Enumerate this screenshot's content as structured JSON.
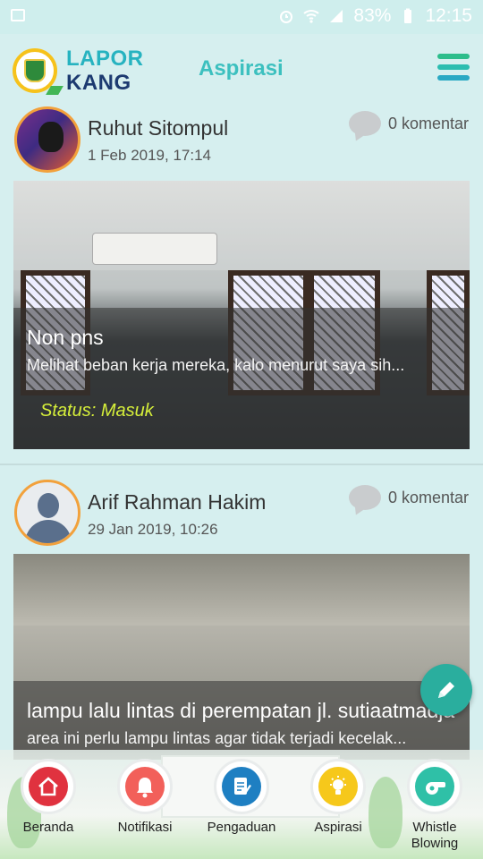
{
  "status_bar": {
    "battery": "83%",
    "time": "12:15"
  },
  "header": {
    "logo_line1": "LAPOR",
    "logo_line2": "KANG",
    "title": "Aspirasi"
  },
  "posts": [
    {
      "author": "Ruhut Sitompul",
      "date": "1 Feb 2019, 17:14",
      "comments": "0 komentar",
      "title": "Non pns",
      "description": "Melihat beban kerja mereka, kalo menurut saya sih...",
      "status": "Status: Masuk"
    },
    {
      "author": "Arif Rahman Hakim",
      "date": "29 Jan 2019, 10:26",
      "comments": "0 komentar",
      "title": "lampu lalu lintas di perempatan jl. sutiaatmadja",
      "description": "area ini perlu lampu lintas agar tidak terjadi kecelak..."
    }
  ],
  "bottom_nav": [
    {
      "label": "Beranda",
      "icon": "home-icon",
      "color": "#e0323f"
    },
    {
      "label": "Notifikasi",
      "icon": "bell-icon",
      "color": "#f2605a"
    },
    {
      "label": "Pengaduan",
      "icon": "document-pen-icon",
      "color": "#1e7fc2"
    },
    {
      "label": "Aspirasi",
      "icon": "lightbulb-icon",
      "color": "#f6c81b"
    },
    {
      "label": "Whistle Blowing",
      "icon": "whistle-icon",
      "color": "#2fc0a7"
    }
  ],
  "colors": {
    "accent": "#3cc0bf",
    "status": "#d6ef3a",
    "fab": "#2aae9e"
  }
}
